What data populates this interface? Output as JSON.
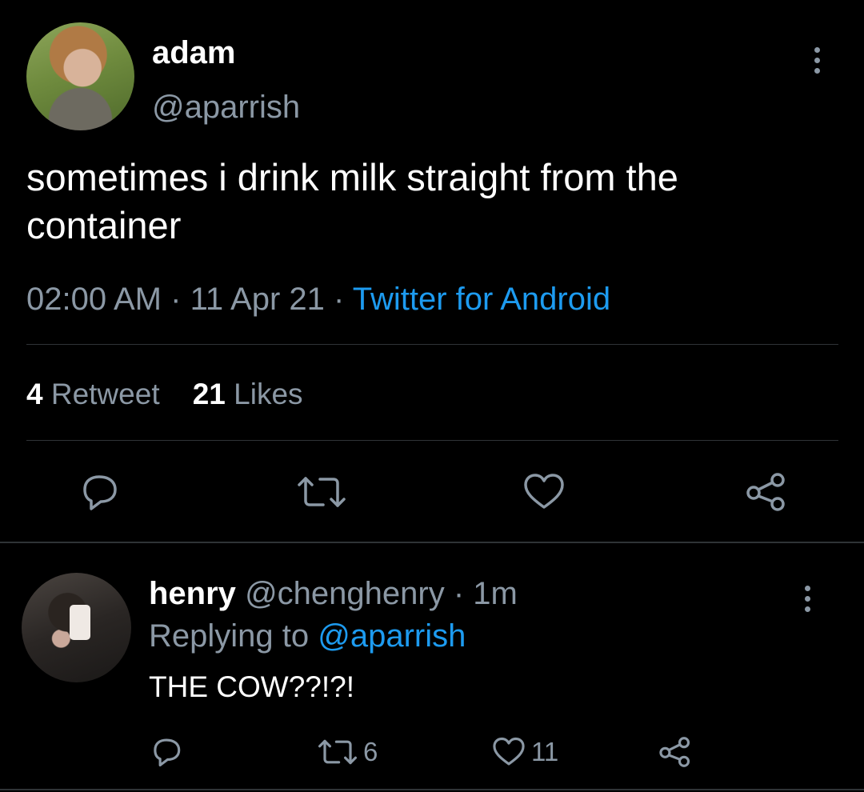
{
  "tweet": {
    "author_name": "adam",
    "author_handle": "@aparrish",
    "text": "sometimes i drink milk straight from the container",
    "time": "02:00 AM",
    "date": "11 Apr 21",
    "source": "Twitter for Android",
    "separator": "·",
    "retweet_count": "4",
    "retweet_label": "Retweet",
    "like_count": "21",
    "like_label": "Likes"
  },
  "reply": {
    "author_name": "henry",
    "author_handle": "@chenghenry",
    "separator": "·",
    "time_ago": "1m",
    "replying_label": "Replying to",
    "replying_handle": "@aparrish",
    "text": "THE COW??!?!",
    "retweet_count": "6",
    "like_count": "11"
  },
  "icons": {
    "reply": "reply-icon",
    "retweet": "retweet-icon",
    "like": "heart-icon",
    "share": "share-icon",
    "more": "more-vertical-icon"
  },
  "colors": {
    "background": "#000000",
    "text": "#ffffff",
    "secondary": "#8b98a5",
    "link": "#1d9bf0",
    "divider": "#2f3336"
  }
}
